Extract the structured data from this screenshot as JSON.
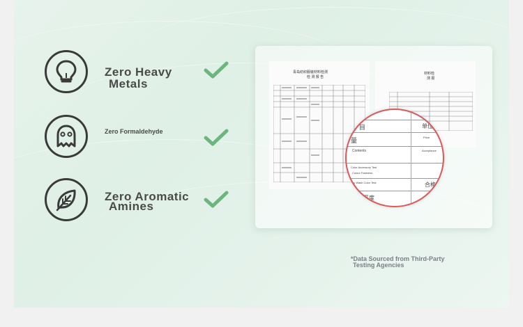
{
  "features": [
    {
      "line1": "Zero Heavy",
      "line2": "Metals",
      "icon": "lightbulb-icon",
      "check": "checkmark-icon"
    },
    {
      "line1": "Zero Formaldehyde",
      "icon": "ghost-icon",
      "check": "checkmark-icon"
    },
    {
      "line1": "Zero Aromatic",
      "line2": "Amines",
      "icon": "leaf-icon",
      "check": "checkmark-icon"
    }
  ],
  "report": {
    "doc1_title": "青岛纺织服装材料检测",
    "doc1_subtitle": "检 测 报 告",
    "doc2_title": "材料检",
    "doc2_subtitle": "测 报",
    "magnifier": {
      "rows": [
        "目",
        "单位",
        "量",
        "Price",
        "Contents",
        "Acceptance",
        "Color Accessory Test",
        "Colour Fastness",
        "Dry Wash Color Test",
        "合格",
        "平度"
      ]
    }
  },
  "footnote": {
    "line1": "*Data Sourced from Third-Party",
    "line2": "Testing Agencies"
  },
  "colors": {
    "check": "#6cb57e",
    "magnifier_border": "#d95a5a",
    "icon_stroke": "#3a3a3a"
  }
}
